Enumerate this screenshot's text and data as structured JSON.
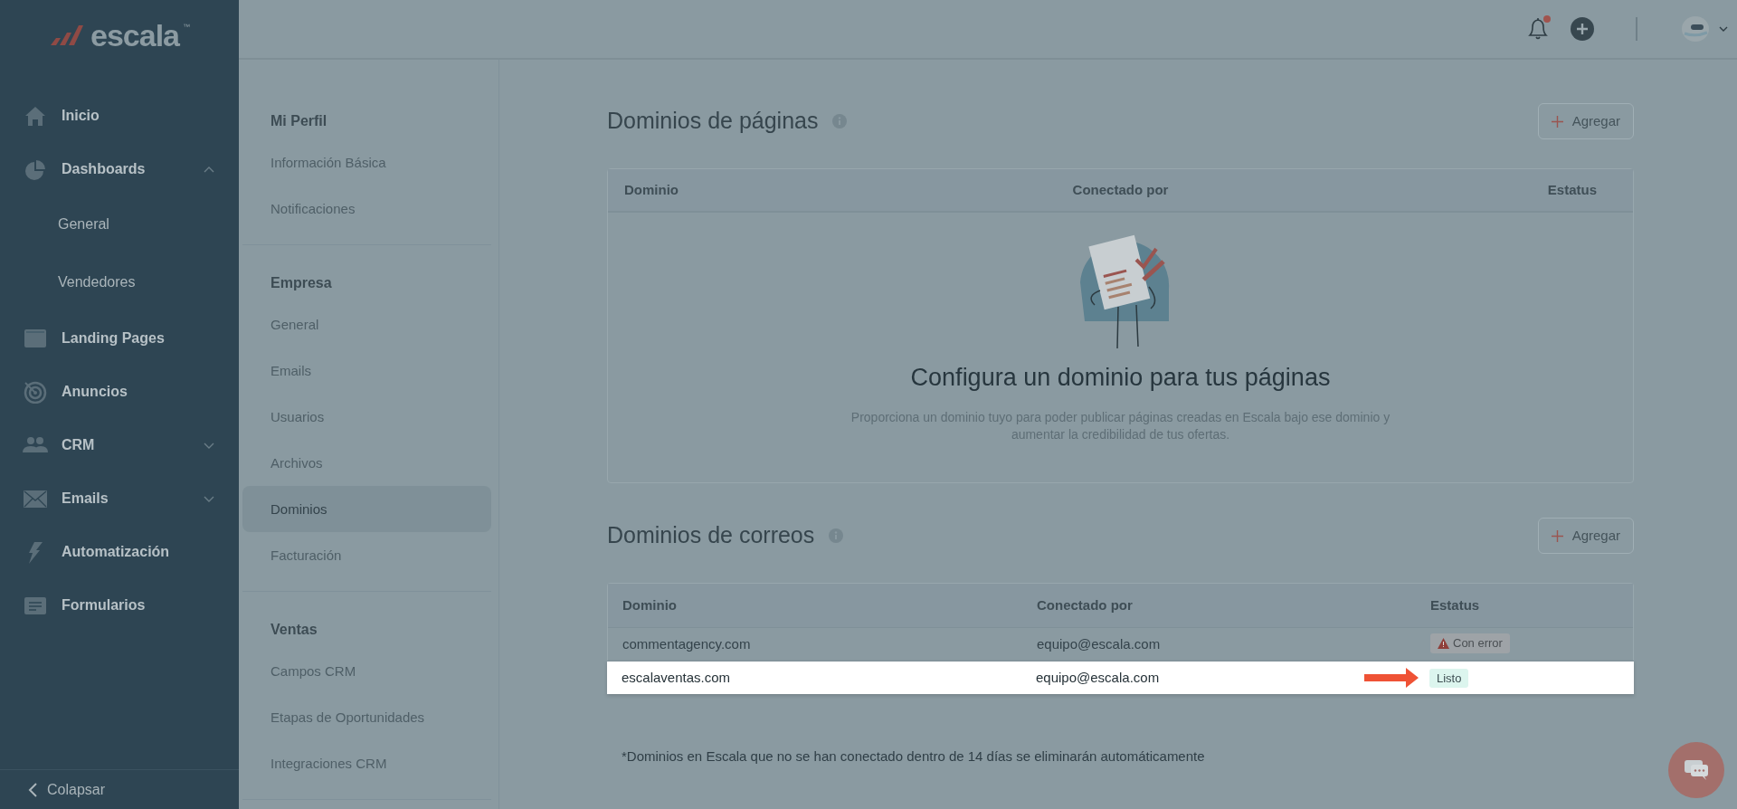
{
  "brand": {
    "name": "escala",
    "trademark": "™"
  },
  "sidebar": {
    "items": [
      {
        "label": "Inicio"
      },
      {
        "label": "Dashboards",
        "expanded": true,
        "children": [
          {
            "label": "General"
          },
          {
            "label": "Vendedores"
          }
        ]
      },
      {
        "label": "Landing Pages"
      },
      {
        "label": "Anuncios"
      },
      {
        "label": "CRM",
        "expanded": false
      },
      {
        "label": "Emails",
        "expanded": false
      },
      {
        "label": "Automatización"
      },
      {
        "label": "Formularios"
      }
    ],
    "collapse": "Colapsar"
  },
  "header": {
    "notifications_unread": true
  },
  "settings_nav": [
    {
      "title": "Mi Perfil",
      "items": [
        {
          "label": "Información Básica",
          "selected": false
        },
        {
          "label": "Notificaciones",
          "selected": false
        }
      ]
    },
    {
      "title": "Empresa",
      "items": [
        {
          "label": "General",
          "selected": false
        },
        {
          "label": "Emails",
          "selected": false
        },
        {
          "label": "Usuarios",
          "selected": false
        },
        {
          "label": "Archivos",
          "selected": false
        },
        {
          "label": "Dominios",
          "selected": true
        },
        {
          "label": "Facturación",
          "selected": false
        }
      ]
    },
    {
      "title": "Ventas",
      "items": [
        {
          "label": "Campos CRM",
          "selected": false
        },
        {
          "label": "Etapas de Oportunidades",
          "selected": false
        },
        {
          "label": "Integraciones CRM",
          "selected": false
        }
      ]
    }
  ],
  "page_domains": {
    "title": "Dominios de páginas",
    "add_button": "Agregar",
    "columns": [
      "Dominio",
      "Conectado por",
      "Estatus"
    ],
    "empty_state": {
      "title": "Configura un dominio para tus páginas",
      "text": "Proporciona un dominio tuyo para poder publicar páginas creadas en Escala bajo ese dominio y aumentar la credibilidad de tus ofertas."
    }
  },
  "email_domains": {
    "title": "Dominios de correos",
    "add_button": "Agregar",
    "columns": [
      "Dominio",
      "Conectado por",
      "Estatus"
    ],
    "rows": [
      {
        "domain": "commentagency.com",
        "connected_by": "equipo@escala.com",
        "status": {
          "label": "Con error",
          "kind": "error"
        },
        "highlighted": false,
        "arrow": false
      },
      {
        "domain": "escalaventas.com",
        "connected_by": "equipo@escala.com",
        "status": {
          "label": "Listo",
          "kind": "ready"
        },
        "highlighted": true,
        "arrow": true
      }
    ],
    "footnote": "*Dominios en Escala que no se han conectado dentro de 14 días se eliminarán automáticamente"
  }
}
